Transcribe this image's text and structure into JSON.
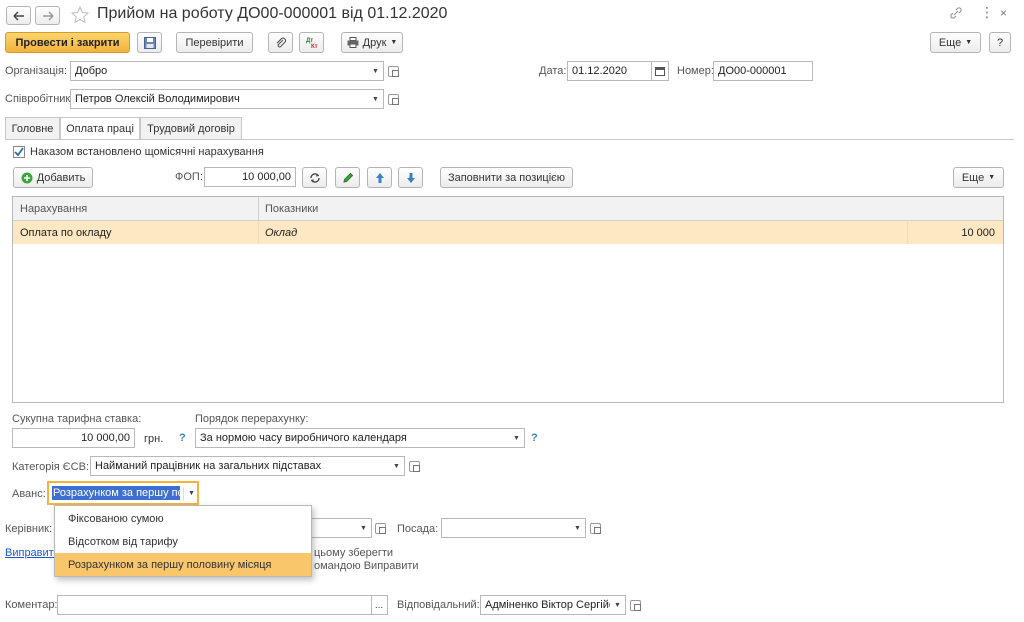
{
  "title": "Прийом на роботу ДО00-000001 від 01.12.2020",
  "toolbar": {
    "post_close": "Провести і закрити",
    "check": "Перевірити",
    "print": "Друк",
    "more": "Еще",
    "help": "?"
  },
  "header": {
    "org_label": "Організація:",
    "org_value": "Добро",
    "date_label": "Дата:",
    "date_value": "01.12.2020",
    "number_label": "Номер:",
    "number_value": "ДО00-000001",
    "employee_label": "Співробітник:",
    "employee_value": "Петров Олексій Володимирович"
  },
  "tabs": [
    "Головне",
    "Оплата праці",
    "Трудовий договір"
  ],
  "pay": {
    "monthly_checkbox": "Наказом встановлено щомісячні нарахування",
    "add_button": "Добавить",
    "fop_label": "ФОП:",
    "fop_value": "10 000,00",
    "fill_button": "Заповнити за позицією",
    "more": "Еще",
    "columns": [
      "Нарахування",
      "Показники"
    ],
    "rows": [
      {
        "accrual": "Оплата по окладу",
        "indicator": "Оклад",
        "value": "10 000"
      }
    ],
    "total_rate_label": "Сукупна тарифна ставка:",
    "total_rate_value": "10 000,00",
    "currency": "грн.",
    "recalc_label": "Порядок перерахунку:",
    "recalc_value": "За нормою часу виробничого календаря",
    "esv_label": "Категорія ЄСВ:",
    "esv_value": "Найманий працівник на загальних підставах",
    "advance_label": "Аванс:",
    "advance_value": "Розрахунком за першу по"
  },
  "dropdown": {
    "options": [
      "Фіксованою сумою",
      "Відсотком від тарифу",
      "Розрахунком за першу половину місяця"
    ],
    "selected_index": 2
  },
  "footer": {
    "manager_label": "Керівник:",
    "position_label": "Посада:",
    "fix_link": "Виправити",
    "fix_note_line1": "цьому зберегти",
    "fix_note_line2": "омандою Виправити",
    "comment_label": "Коментар:",
    "comment_value": "",
    "responsible_label": "Відповідальний:",
    "responsible_value": "Адміненко Віктор Сергійо",
    "ellipsis": "..."
  },
  "help_mark": "?",
  "colors": {
    "accent": "#f3b33f",
    "selection": "#fde8c3",
    "highlight": "#3d6fd1",
    "dropdown_selected": "#f9c66b"
  }
}
